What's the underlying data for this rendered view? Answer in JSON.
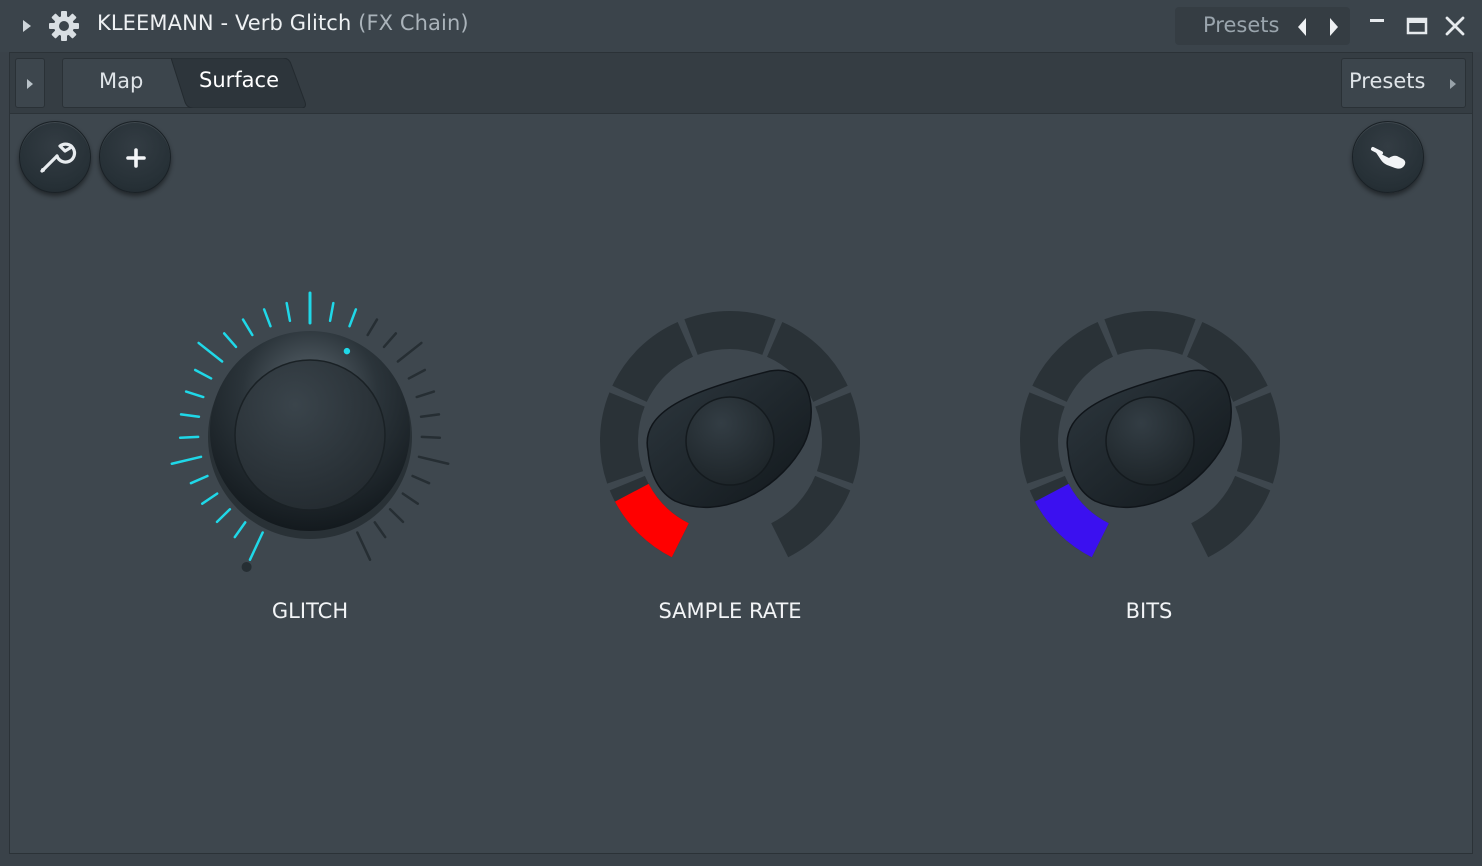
{
  "window": {
    "title": "KLEEMANN - Verb Glitch",
    "subtitle": "(FX Chain)",
    "presets_label": "Presets"
  },
  "tabs": [
    {
      "label": "Map",
      "active": false
    },
    {
      "label": "Surface",
      "active": true
    }
  ],
  "surface_presets_label": "Presets",
  "toolbar": {
    "icons": [
      "wrench-icon",
      "plus-icon",
      "hand-pointer-icon"
    ]
  },
  "knobs": [
    {
      "label": "GLITCH",
      "style": "tick-ring",
      "accent": "#1fd8e8",
      "value": 0.58
    },
    {
      "label": "SAMPLE RATE",
      "style": "segmented-arc",
      "accent": "#ff0000",
      "value": 0.12
    },
    {
      "label": "BITS",
      "style": "segmented-arc",
      "accent": "#3b10f0",
      "value": 0.12
    }
  ],
  "colors": {
    "background": "#3e474e",
    "titlebar": "#3b444b",
    "tab_strip": "#353d43"
  }
}
